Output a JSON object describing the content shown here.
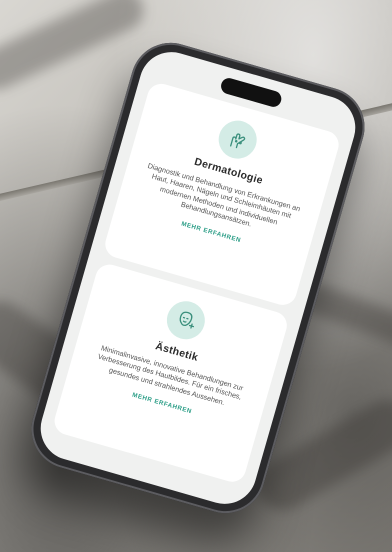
{
  "cards": [
    {
      "icon": "hand-icon",
      "title": "Dermatologie",
      "text": "Diagnostik und Behandlung von Erkrankungen an Haut, Haaren, Nägeln und Schleimhäuten mit modernen Methoden und individuellen Behandlungsansätzen.",
      "link": "MEHR ERFAHREN"
    },
    {
      "icon": "face-sparkle-icon",
      "title": "Ästhetik",
      "text": "Minimalinvasive, innovative Behandlungen zur Verbesserung des Hautbildes. Für ein frisches, gesundes und strahlendes Aussehen.",
      "link": "MEHR ERFAHREN"
    }
  ],
  "colors": {
    "accent": "#2a9d86",
    "icon_bg": "#d4ece6",
    "card_bg": "#ffffff",
    "screen_bg": "#f0f1f0"
  }
}
